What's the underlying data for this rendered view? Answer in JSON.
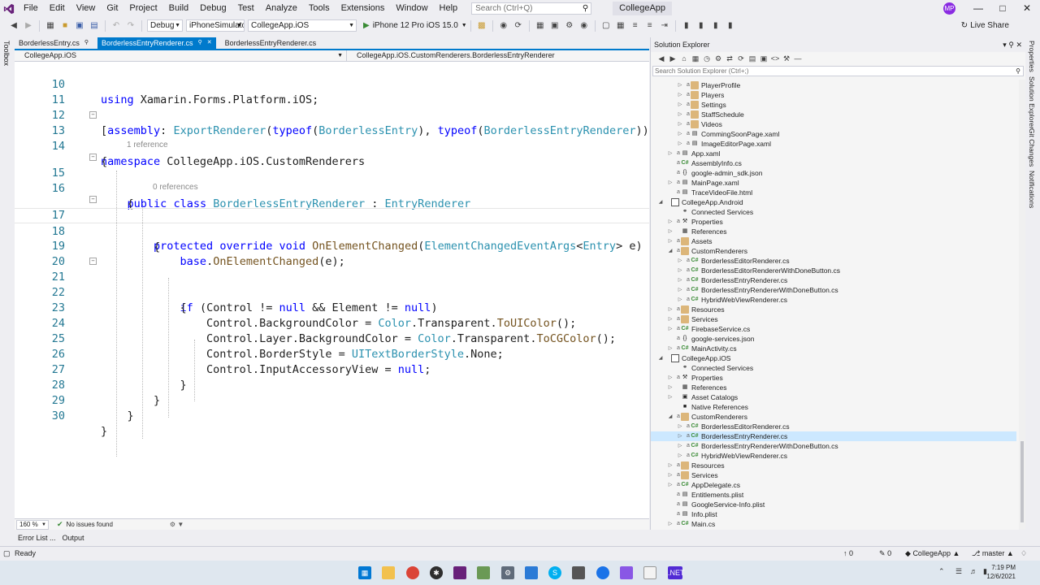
{
  "menu": [
    "File",
    "Edit",
    "View",
    "Git",
    "Project",
    "Build",
    "Debug",
    "Test",
    "Analyze",
    "Tools",
    "Extensions",
    "Window",
    "Help"
  ],
  "search": {
    "placeholder": "Search (Ctrl+Q)"
  },
  "app_title": "CollegeApp",
  "user_initials": "MP",
  "toolbar": {
    "configuration": "Debug",
    "platform": "iPhoneSimulator",
    "startup_project": "CollegeApp.iOS",
    "run_target": "iPhone 12 Pro iOS 15.0",
    "live_share": "Live Share"
  },
  "toolbox_label": "Toolbox",
  "doc_tabs": [
    {
      "label": "BorderlessEntry.cs",
      "active": false
    },
    {
      "label": "BorderlessEntryRenderer.cs",
      "active": true
    },
    {
      "label": "BorderlessEntryRenderer.cs",
      "active": false
    }
  ],
  "nav_bar": {
    "project": "CollegeApp.iOS",
    "type": "CollegeApp.iOS.CustomRenderers.BorderlessEntryRenderer"
  },
  "code": {
    "line_numbers": [
      "10",
      "11",
      "12",
      "13",
      "14",
      "15",
      "16",
      "17",
      "18",
      "19",
      "20",
      "21",
      "22",
      "23",
      "24",
      "25",
      "26",
      "27",
      "28",
      "29",
      "30"
    ],
    "ref_hints": [
      "1 reference",
      "0 references"
    ]
  },
  "editor_status": {
    "zoom": "160 %",
    "issues": "No issues found"
  },
  "bottom_tabs": [
    "Error List ...",
    "Output"
  ],
  "status": {
    "text": "Ready",
    "up_count": "0",
    "pencil_count": "0",
    "repo": "CollegeApp",
    "branch": "master"
  },
  "solution_explorer": {
    "title": "Solution Explorer",
    "search_placeholder": "Search Solution Explorer (Ctrl+;)",
    "items": [
      {
        "label": "PlayerProfile",
        "icon": "folder-icon"
      },
      {
        "label": "Players",
        "icon": "folder-icon"
      },
      {
        "label": "Settings",
        "icon": "folder-icon"
      },
      {
        "label": "StaffSchedule",
        "icon": "folder-icon"
      },
      {
        "label": "Videos",
        "icon": "folder-icon"
      },
      {
        "label": "CommingSoonPage.xaml",
        "icon": "xaml-icon"
      },
      {
        "label": "ImageEditorPage.xaml",
        "icon": "xaml-icon"
      },
      {
        "label": "App.xaml",
        "icon": "xaml-icon"
      },
      {
        "label": "AssemblyInfo.cs",
        "icon": "csharp-icon"
      },
      {
        "label": "google-admin_sdk.json",
        "icon": "json-icon"
      },
      {
        "label": "MainPage.xaml",
        "icon": "xaml-icon"
      },
      {
        "label": "TraceVideoFile.html",
        "icon": "html-icon"
      },
      {
        "label": "CollegeApp.Android",
        "icon": "project-icon"
      },
      {
        "label": "Connected Services",
        "icon": "connected-services-icon"
      },
      {
        "label": "Properties",
        "icon": "wrench-icon"
      },
      {
        "label": "References",
        "icon": "references-icon"
      },
      {
        "label": "Assets",
        "icon": "folder-icon"
      },
      {
        "label": "CustomRenderers",
        "icon": "folder-open-icon"
      },
      {
        "label": "BorderlessEditorRenderer.cs",
        "icon": "csharp-icon"
      },
      {
        "label": "BorderlessEditorRendererWithDoneButton.cs",
        "icon": "csharp-icon"
      },
      {
        "label": "BorderlessEntryRenderer.cs",
        "icon": "csharp-icon"
      },
      {
        "label": "BorderlessEntryRendererWithDoneButton.cs",
        "icon": "csharp-icon"
      },
      {
        "label": "HybridWebViewRenderer.cs",
        "icon": "csharp-icon"
      },
      {
        "label": "Resources",
        "icon": "folder-icon"
      },
      {
        "label": "Services",
        "icon": "folder-icon"
      },
      {
        "label": "FirebaseService.cs",
        "icon": "csharp-icon"
      },
      {
        "label": "google-services.json",
        "icon": "json-icon"
      },
      {
        "label": "MainActivity.cs",
        "icon": "csharp-icon"
      },
      {
        "label": "CollegeApp.iOS",
        "icon": "project-icon"
      },
      {
        "label": "Connected Services",
        "icon": "connected-services-icon"
      },
      {
        "label": "Properties",
        "icon": "wrench-icon"
      },
      {
        "label": "References",
        "icon": "references-icon"
      },
      {
        "label": "Asset Catalogs",
        "icon": "asset-catalog-icon"
      },
      {
        "label": "Native References",
        "icon": "native-references-icon"
      },
      {
        "label": "CustomRenderers",
        "icon": "folder-open-icon"
      },
      {
        "label": "BorderlessEditorRenderer.cs",
        "icon": "csharp-icon"
      },
      {
        "label": "BorderlessEntryRenderer.cs",
        "icon": "csharp-icon"
      },
      {
        "label": "BorderlessEntryRendererWithDoneButton.cs",
        "icon": "csharp-icon"
      },
      {
        "label": "HybridWebViewRenderer.cs",
        "icon": "csharp-icon"
      },
      {
        "label": "Resources",
        "icon": "folder-icon"
      },
      {
        "label": "Services",
        "icon": "folder-icon"
      },
      {
        "label": "AppDelegate.cs",
        "icon": "csharp-icon"
      },
      {
        "label": "Entitlements.plist",
        "icon": "plist-icon"
      },
      {
        "label": "GoogleService-Info.plist",
        "icon": "plist-icon"
      },
      {
        "label": "Info.plist",
        "icon": "plist-icon"
      },
      {
        "label": "Main.cs",
        "icon": "csharp-icon"
      }
    ]
  },
  "right_strip": [
    "Properties",
    "Solution Explorer",
    "Git Changes",
    "Notifications"
  ],
  "clock": {
    "time": "7:19 PM",
    "date": "12/6/2021"
  },
  "colors": {
    "accent": "#007acc",
    "selection": "#cce8ff",
    "keyword": "#0000ff",
    "type": "#2b91af"
  }
}
